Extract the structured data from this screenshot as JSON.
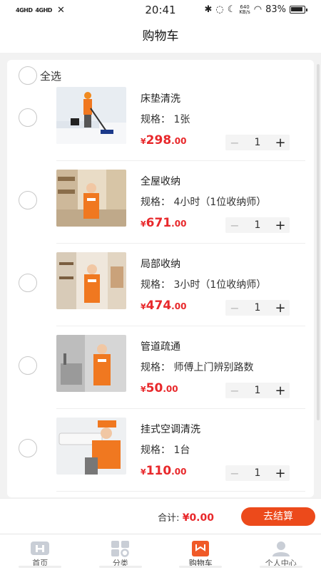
{
  "status": {
    "signal1": "4GHD",
    "signal2": "4GHD",
    "time": "20:41",
    "net_speed_top": "640",
    "net_speed_bottom": "KB/s",
    "battery": "83%"
  },
  "header": {
    "title": "购物车"
  },
  "select_all": {
    "label": "全选"
  },
  "items": [
    {
      "name": "床垫清洗",
      "spec": "规格：  1张",
      "yen": "¥",
      "price_int": "298",
      "price_dec": ".00",
      "qty": "1",
      "image": "mattress-cleaning-photo"
    },
    {
      "name": "全屋收纳",
      "spec": "规格：  4小时（1位收纳师）",
      "yen": "¥",
      "price_int": "671",
      "price_dec": ".00",
      "qty": "1",
      "image": "whole-house-storage-photo"
    },
    {
      "name": "局部收纳",
      "spec": "规格：  3小时（1位收纳师）",
      "yen": "¥",
      "price_int": "474",
      "price_dec": ".00",
      "qty": "1",
      "image": "partial-storage-photo"
    },
    {
      "name": "管道疏通",
      "spec": "规格：  师傅上门辨别路数",
      "yen": "¥",
      "price_int": "50",
      "price_dec": ".00",
      "qty": "1",
      "image": "pipe-unclogging-photo"
    },
    {
      "name": "挂式空调清洗",
      "spec": "规格：  1台",
      "yen": "¥",
      "price_int": "110",
      "price_dec": ".00",
      "qty": "1",
      "image": "ac-cleaning-photo"
    }
  ],
  "stepper": {
    "minus": "−",
    "plus": "+"
  },
  "checkout": {
    "total_label": "合计:",
    "total_amount": "¥0.00",
    "button_label": "去结算"
  },
  "tabs": [
    {
      "label": "首页",
      "icon": "home-icon"
    },
    {
      "label": "分类",
      "icon": "category-icon"
    },
    {
      "label": "购物车",
      "icon": "cart-icon",
      "active": true
    },
    {
      "label": "个人中心",
      "icon": "profile-icon"
    }
  ],
  "colors": {
    "accent": "#ec4a1b",
    "price": "#e8282b",
    "tab_active": "#f05a28"
  }
}
